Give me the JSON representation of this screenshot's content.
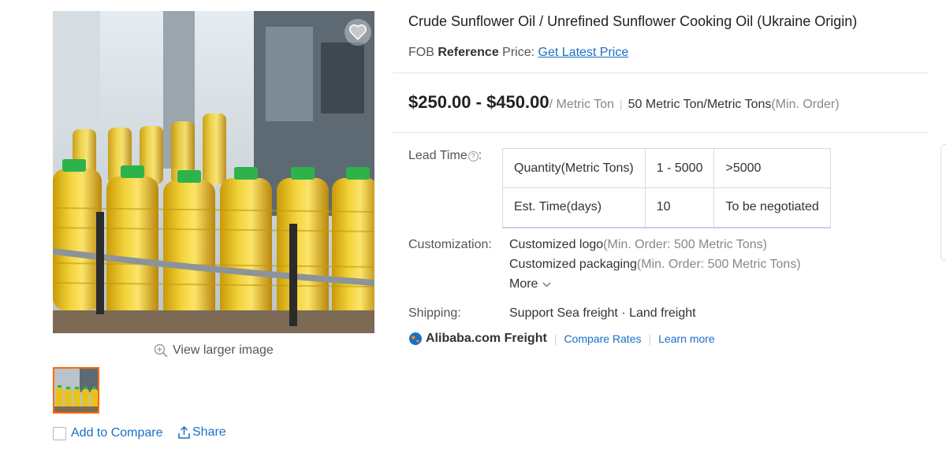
{
  "gallery": {
    "view_larger": "View larger image",
    "add_to_compare": "Add to Compare",
    "share": "Share",
    "icons": {
      "favorite": "heart-icon",
      "zoom": "magnifier-plus-icon",
      "share": "share-icon"
    }
  },
  "product": {
    "title": "Crude Sunflower Oil / Unrefined Sunflower Cooking Oil (Ukraine Origin)",
    "ref_prefix": "FOB",
    "ref_bold": "Reference",
    "ref_suffix": "Price:",
    "latest_price_link": "Get Latest Price",
    "price_range": "$250.00 - $450.00",
    "price_unit": "/ Metric Ton",
    "price_sep": "|",
    "moq": "50 Metric Ton/Metric Tons",
    "moq_note": "(Min. Order)"
  },
  "lead_time": {
    "label": "Lead Time",
    "label_suffix": ":",
    "rows": [
      [
        "Quantity(Metric Tons)",
        "1 - 5000",
        ">5000"
      ],
      [
        "Est. Time(days)",
        "10",
        "To be negotiated"
      ]
    ]
  },
  "customization": {
    "label": "Customization:",
    "items": [
      {
        "name": "Customized logo",
        "note": "(Min. Order: 500 Metric Tons)"
      },
      {
        "name": "Customized packaging",
        "note": "(Min. Order: 500 Metric Tons)"
      }
    ],
    "more": "More"
  },
  "shipping": {
    "label": "Shipping:",
    "value": "Support Sea freight · Land freight"
  },
  "freight": {
    "brand": "Alibaba.com Freight",
    "compare_rates": "Compare Rates",
    "learn_more": "Learn more",
    "sep": "|"
  },
  "colors": {
    "link": "#1a6fc9",
    "thumb_border": "#ff6a00",
    "oil": "#e8c21a",
    "cap": "#2db34a"
  }
}
